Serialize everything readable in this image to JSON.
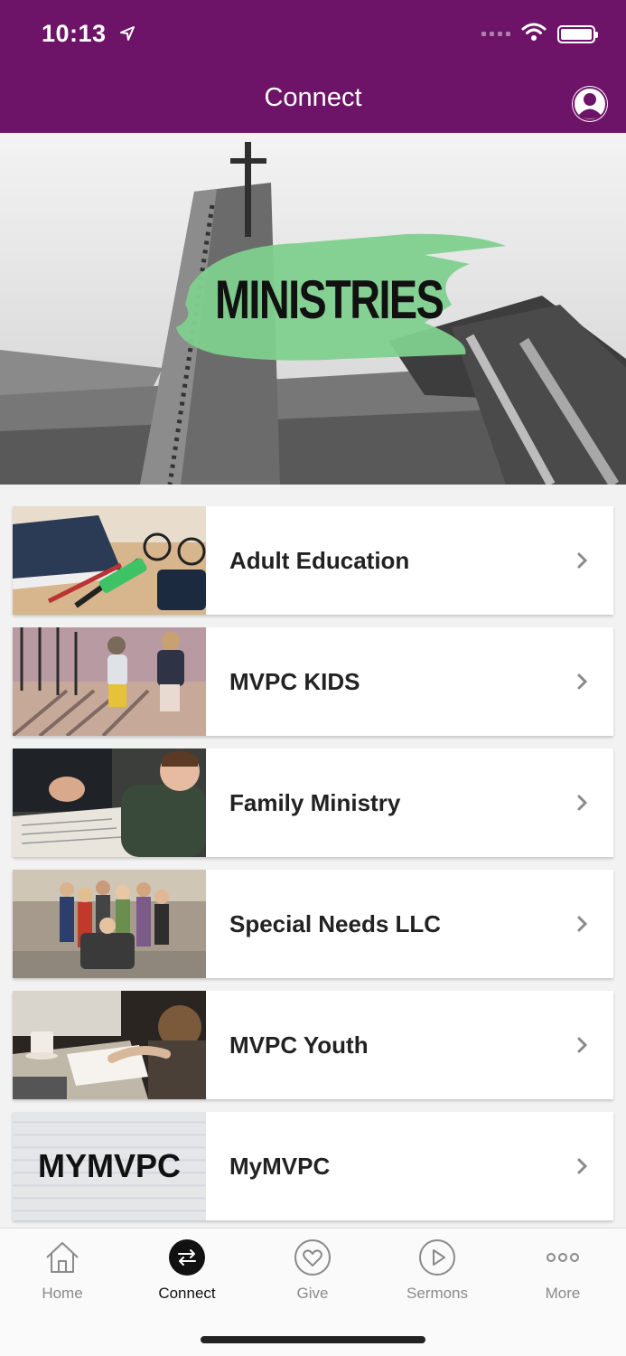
{
  "status": {
    "time": "10:13"
  },
  "header": {
    "title": "Connect"
  },
  "hero": {
    "label": "MINISTRIES"
  },
  "items": [
    {
      "label": "Adult Education"
    },
    {
      "label": "MVPC KIDS"
    },
    {
      "label": "Family Ministry"
    },
    {
      "label": "Special Needs LLC"
    },
    {
      "label": "MVPC Youth"
    },
    {
      "label": "MyMVPC",
      "thumb_text": "MYMVPC"
    }
  ],
  "tabs": [
    {
      "label": "Home",
      "icon": "home-icon"
    },
    {
      "label": "Connect",
      "icon": "connect-icon",
      "active": true
    },
    {
      "label": "Give",
      "icon": "heart-icon"
    },
    {
      "label": "Sermons",
      "icon": "play-icon"
    },
    {
      "label": "More",
      "icon": "more-icon"
    }
  ],
  "colors": {
    "brand": "#6e1468",
    "hero_accent": "#7fd08e"
  }
}
